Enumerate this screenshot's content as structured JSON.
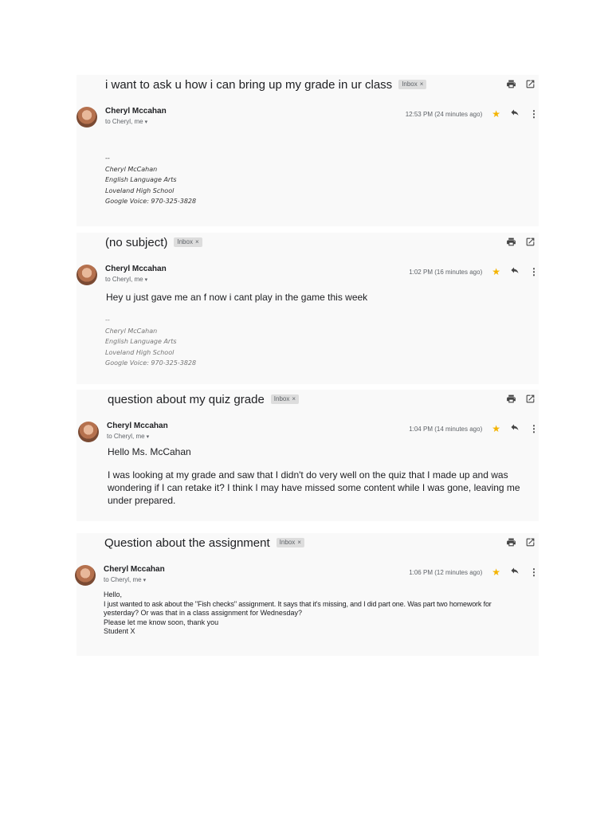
{
  "emails": [
    {
      "subject": "i want to ask u how i can bring up my grade in ur class",
      "label": "Inbox",
      "sender": "Cheryl Mccahan",
      "recipient": "to Cheryl, me",
      "time": "12:53 PM (24 minutes ago)",
      "body": [],
      "signature": [
        "--",
        "Cheryl McCahan",
        "English Language Arts",
        "Loveland High School",
        "Google Voice:  970-325-3828"
      ]
    },
    {
      "subject": "(no subject)",
      "label": "Inbox",
      "sender": "Cheryl Mccahan",
      "recipient": "to Cheryl, me",
      "time": "1:02 PM (16 minutes ago)",
      "body": [
        "Hey u just gave me an f now i cant play in the game this week"
      ],
      "signature": [
        "--",
        "Cheryl McCahan",
        "English Language Arts",
        "Loveland High School",
        "Google Voice:  970-325-3828"
      ]
    },
    {
      "subject": "question about my quiz grade",
      "label": "Inbox",
      "sender": "Cheryl Mccahan",
      "recipient": "to Cheryl, me",
      "time": "1:04 PM (14 minutes ago)",
      "body": [
        "Hello Ms. McCahan",
        "I was looking at my grade and saw that I didn't do very well on the quiz that I made up and was",
        "wondering if I can retake it? I think I may have missed some content while I was gone, leaving me",
        "under prepared."
      ],
      "signature": []
    },
    {
      "subject": "Question about the assignment",
      "label": "Inbox",
      "sender": "Cheryl Mccahan",
      "recipient": "to Cheryl, me",
      "time": "1:06 PM (12 minutes ago)",
      "body": [
        "Hello,",
        "I just wanted to ask about the \"Fish checks\" assignment. It says that it's missing, and I did part one. Was part two homework for",
        "yesterday? Or was that in a class assignment for Wednesday?",
        "Please let me know soon, thank you",
        "Student X"
      ],
      "signature": []
    }
  ],
  "icons": {
    "print": "print-icon",
    "open": "open-in-new-window-icon",
    "star": "star-icon",
    "reply": "reply-icon",
    "more": "more-vert-icon",
    "caret": "chevron-down-icon",
    "chip_close": "close-icon"
  },
  "colors": {
    "star": "#f4b400",
    "chip_bg": "#dddddd",
    "card_bg": "#f9f9f9"
  }
}
